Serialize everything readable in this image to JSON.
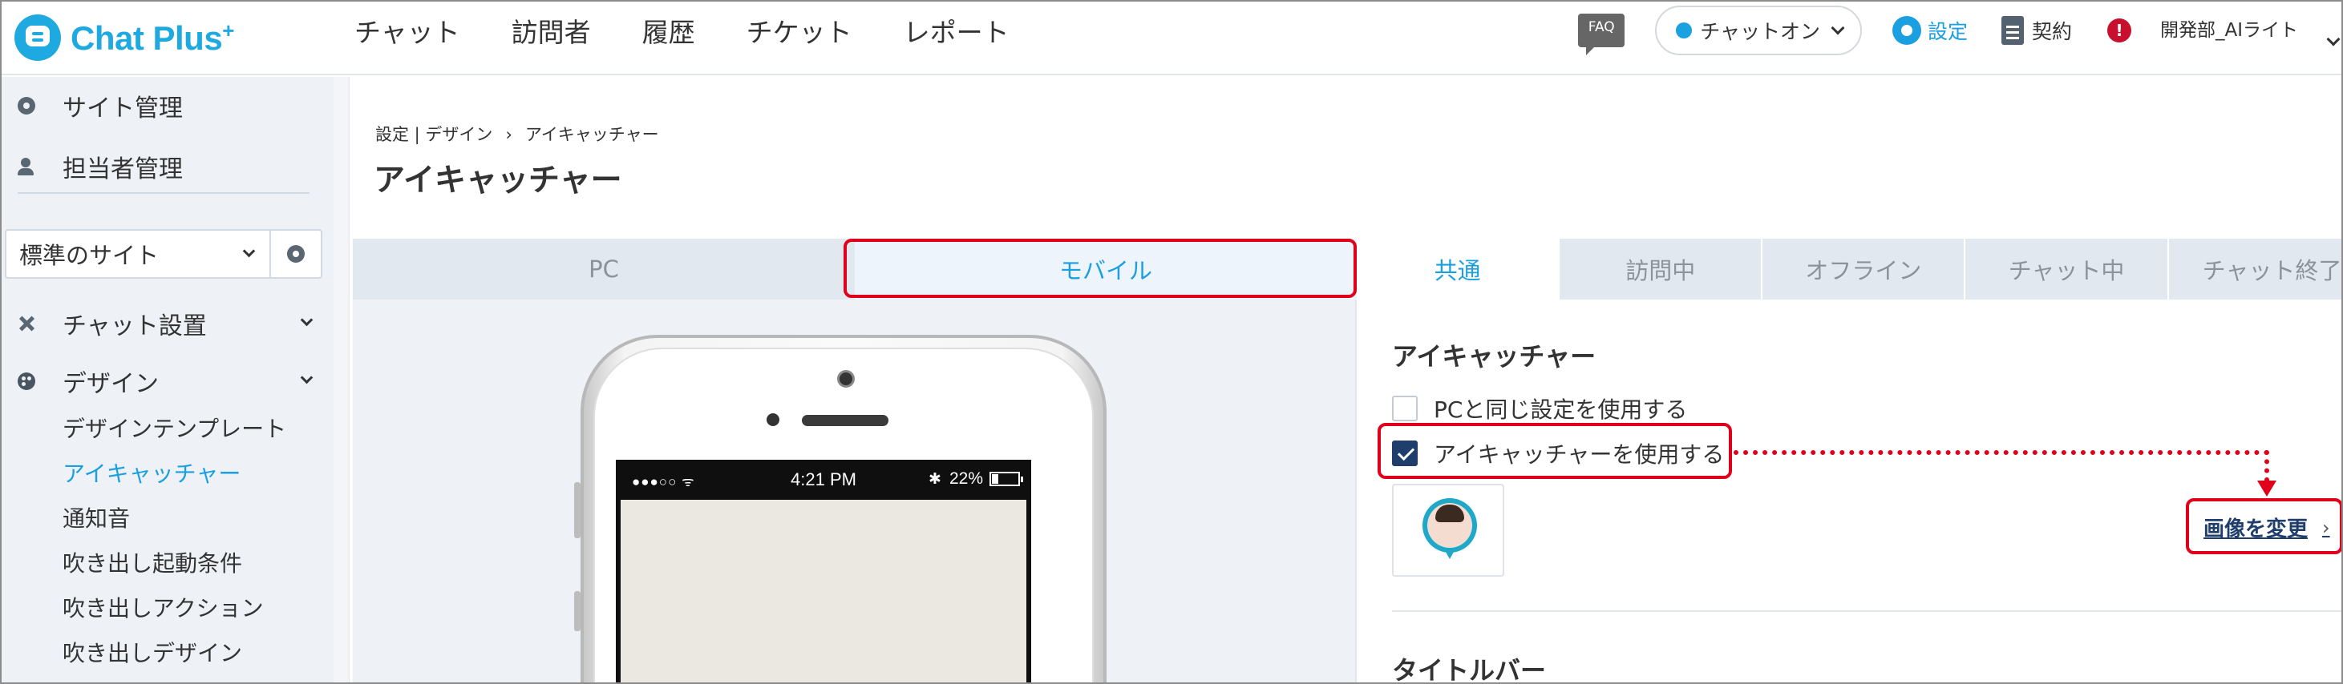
{
  "app": {
    "logo_text": "Chat Plus",
    "logo_sup": "+"
  },
  "topnav": [
    "チャット",
    "訪問者",
    "履歴",
    "チケット",
    "レポート"
  ],
  "header": {
    "faq": "FAQ",
    "status": "チャットオン",
    "settings": "設定",
    "contract": "契約",
    "alert": "!",
    "user": "開発部_AIライト"
  },
  "sidebar": {
    "site_manage": "サイト管理",
    "staff_manage": "担当者管理",
    "site_select": "標準のサイト",
    "chat_setup": "チャット設置",
    "design": "デザイン",
    "sub_items": [
      "デザインテンプレート",
      "アイキャッチャー",
      "通知音",
      "吹き出し起動条件",
      "吹き出しアクション",
      "吹き出しデザイン"
    ]
  },
  "breadcrumb": {
    "part1": "設定 | デザイン",
    "sep": "›",
    "part2": "アイキャッチャー"
  },
  "page_title": "アイキャッチャー",
  "device_tabs": [
    "PC",
    "モバイル"
  ],
  "section_tabs": [
    "共通",
    "訪問中",
    "オフライン",
    "チャット中",
    "チャット終了"
  ],
  "phone": {
    "signal": "●●●○○ ᯤ",
    "time": "4:21 PM",
    "bluetooth": "✱",
    "battery": "22%"
  },
  "settings_panel": {
    "heading": "アイキャッチャー",
    "option_same_as_pc": "PCと同じ設定を使用する",
    "option_use_eyecatcher": "アイキャッチャーを使用する",
    "change_image": "画像を変更",
    "change_arrow": "›",
    "next_heading": "タイトルバー"
  },
  "colors": {
    "accent": "#1a9fe0",
    "annotation": "#e0001b",
    "navy": "#1f3e6b",
    "sidebar_bg": "#eef2f7"
  }
}
